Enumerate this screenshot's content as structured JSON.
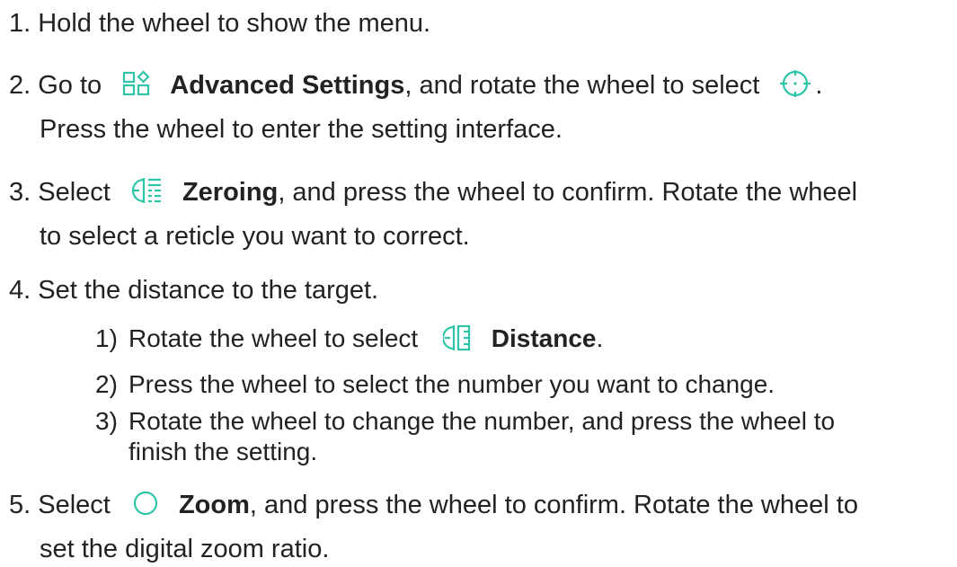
{
  "steps": {
    "s1": {
      "text": "1. Hold the wheel to show the menu."
    },
    "s2": {
      "pre": "2. Go to",
      "icon1": "advanced-settings-icon",
      "bold": "Advanced Settings",
      "mid": ", and rotate the wheel to select",
      "icon2": "reticle-crosshair-icon",
      "end": ".",
      "line2": "Press the wheel to enter the setting interface."
    },
    "s3": {
      "pre": "3. Select",
      "icon": "zeroing-icon",
      "bold": "Zeroing",
      "post": ", and press the wheel to confirm. Rotate the wheel",
      "line2": "to select a reticle you want to correct."
    },
    "s4": {
      "text": "4. Set the distance to the target.",
      "sub1": {
        "num": "1)",
        "pre": "Rotate the wheel to select",
        "icon": "distance-icon",
        "bold": "Distance",
        "end": "."
      },
      "sub2": {
        "num": "2)",
        "text": "Press the wheel to select the number you want to change."
      },
      "sub3": {
        "num": "3)",
        "text": "Rotate the wheel to change the number, and press the wheel to",
        "line2": "finish the setting."
      }
    },
    "s5": {
      "pre": "5. Select",
      "icon": "zoom-icon",
      "bold": "Zoom",
      "post": ", and press the wheel to confirm. Rotate the wheel to",
      "line2": "set the digital zoom ratio."
    }
  },
  "colors": {
    "text": "#222222",
    "icon_accent": "#2ec4a7"
  }
}
